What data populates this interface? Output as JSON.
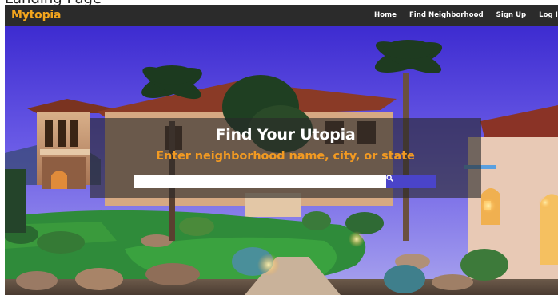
{
  "page_caption": "Landing Page",
  "navbar": {
    "brand": "Mytopia",
    "links": [
      {
        "label": "Home"
      },
      {
        "label": "Find Neighborhood"
      },
      {
        "label": "Sign Up"
      },
      {
        "label": "Log In"
      }
    ]
  },
  "hero": {
    "headline": "Find Your Utopia",
    "subheadline": "Enter neighborhood name, city, or state",
    "search": {
      "value": "",
      "placeholder": "",
      "button_icon": "search-icon"
    }
  },
  "colors": {
    "navbar_bg": "#2b2b2b",
    "brand": "#f3a51d",
    "accent_orange": "#f29a22",
    "search_button": "#4a44c9",
    "overlay": "rgba(40,40,40,0.62)"
  }
}
